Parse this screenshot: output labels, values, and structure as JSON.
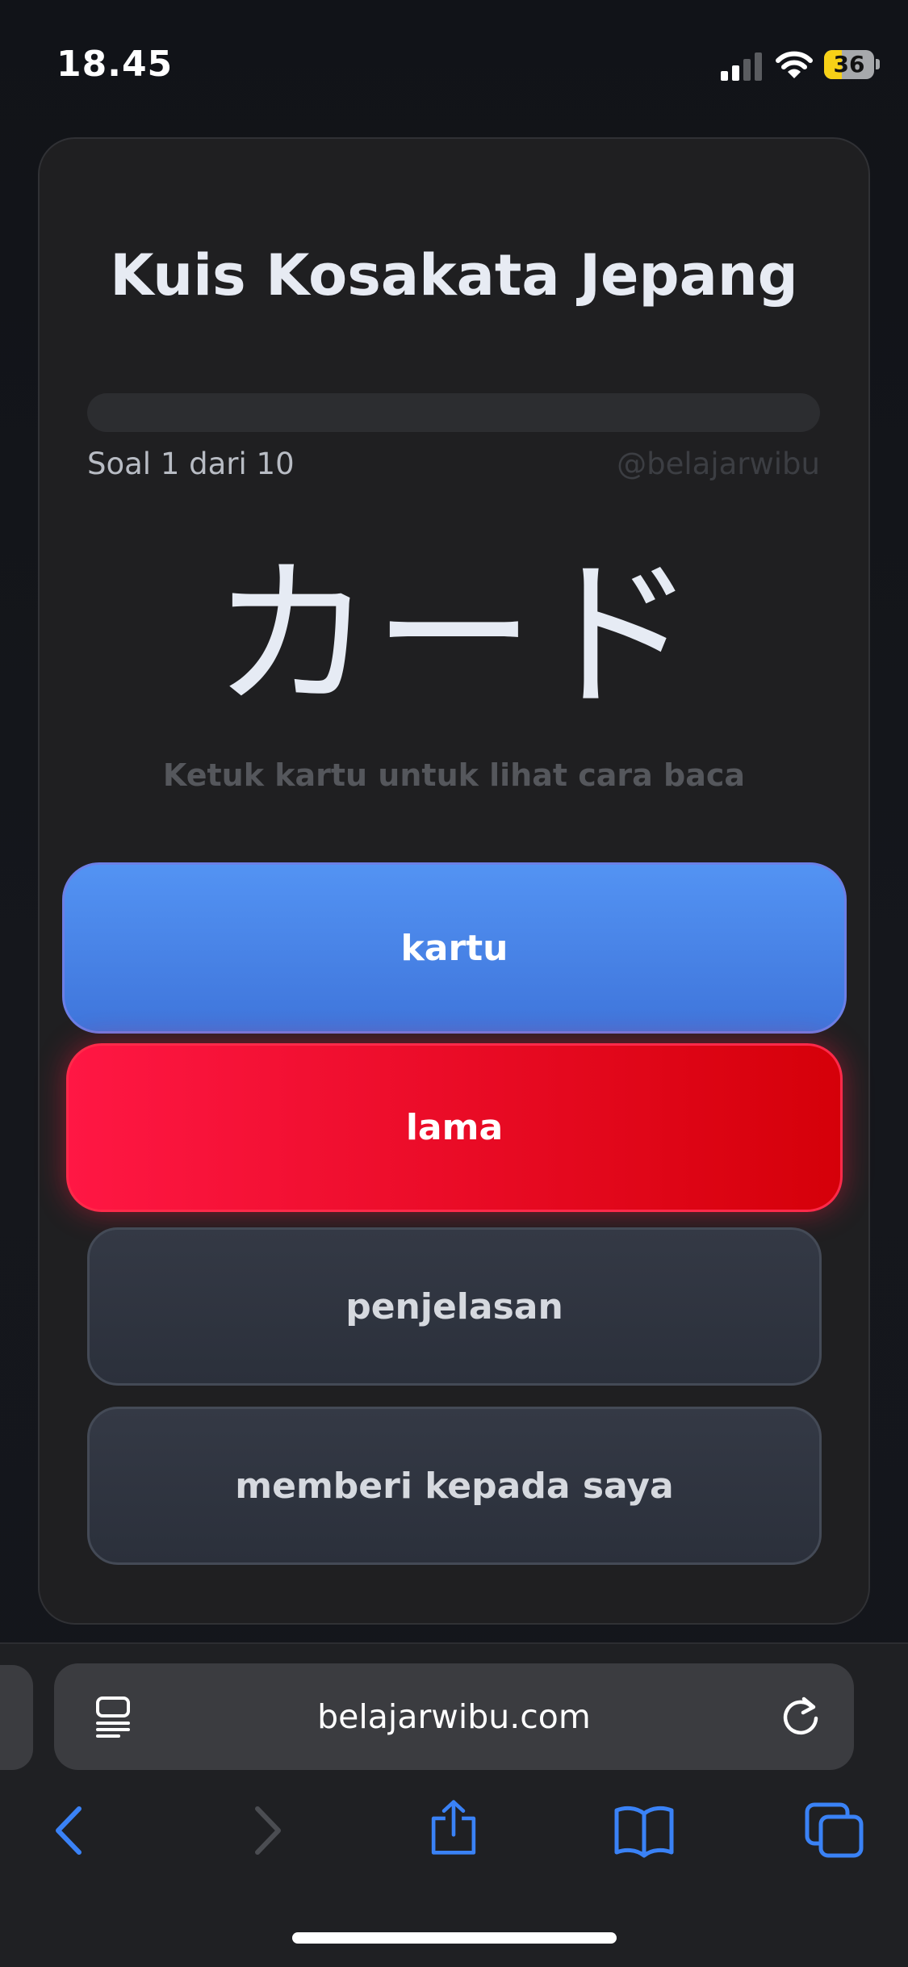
{
  "status_bar": {
    "time": "18.45",
    "signal_bars_active": 2,
    "signal_bars_total": 4,
    "battery_percent": "36",
    "battery_level": 0.36
  },
  "quiz": {
    "title": "Kuis Kosakata Jepang",
    "progress_text": "Soal 1 dari 10",
    "progress_fraction": 0.0,
    "watermark": "@belajarwibu",
    "word": "カード",
    "hint": "Ketuk kartu untuk lihat cara baca",
    "options": [
      {
        "label": "kartu",
        "state": "correct"
      },
      {
        "label": "lama",
        "state": "wrong"
      },
      {
        "label": "penjelasan",
        "state": "neutral"
      },
      {
        "label": "memberi kepada saya",
        "state": "neutral"
      }
    ]
  },
  "browser": {
    "url": "belajarwibu.com",
    "icons": [
      "reader-icon",
      "reload-icon",
      "back-icon",
      "forward-icon",
      "share-icon",
      "bookmarks-icon",
      "tabs-icon"
    ]
  },
  "colors": {
    "accent_blue": "#3F7DE8",
    "correct_option": "#4A86EC",
    "wrong_option": "#E8102A",
    "card_background": "#1F1F21",
    "toolbar_icon_blue": "#3A82F6",
    "toolbar_icon_disabled": "#4B4D52"
  }
}
